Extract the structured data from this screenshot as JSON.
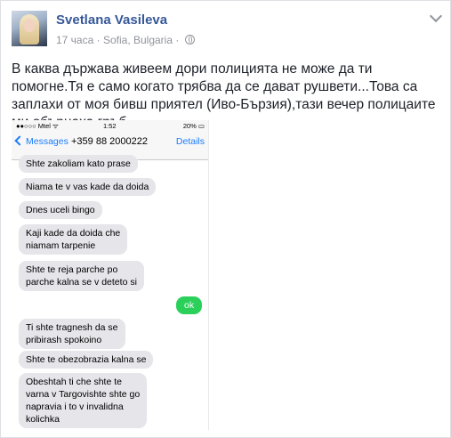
{
  "post": {
    "author": "Svetlana Vasileva",
    "time": "17 часа",
    "separator": "·",
    "location": "Sofia, Bulgaria",
    "separator2": "·",
    "text": "В каква държава живеем дори полицията не може да ти помогне.Тя е само когато трябва да се дават рушвети...Това са заплахи от моя бивш приятел (Иво-Бързия),тази вечер полицаите ми обърнаха гръб..."
  },
  "icons": {
    "privacy": "globe-icon",
    "menu": "chevron-down-icon",
    "back": "chevron-left-icon"
  },
  "phone": {
    "status": {
      "carrier": "●●○○○ Mtel ᯤ",
      "time": "1:52",
      "battery": "20% ▭"
    },
    "nav": {
      "back": "Messages",
      "number": "+359 88 2000222",
      "details": "Details"
    },
    "messages": [
      {
        "dir": "in",
        "text": "Shte zakoliam kato prase"
      },
      {
        "dir": "in",
        "text": "Niama te v vas kade da doida"
      },
      {
        "dir": "in",
        "text": "Dnes uceli bingo"
      },
      {
        "dir": "in",
        "text": "Kaji kade da doida che\nniamam tarpenie"
      },
      {
        "dir": "in",
        "text": "Shte te reja parche po\nparche kalna se v deteto si"
      },
      {
        "dir": "out",
        "text": "ok"
      },
      {
        "dir": "in",
        "text": "Ti shte tragnesh da se\npribirash spokoino"
      },
      {
        "dir": "in",
        "text": "Shte te obezobrazia kalna se"
      },
      {
        "dir": "in",
        "text": "Obeshtah ti che shte te\nvarna v Targovishte shte go\nnapravia i to v invalidna\nkolichka"
      }
    ]
  },
  "colors": {
    "author": "#365899",
    "ios_blue": "#1a7dfc",
    "bubble_in": "#e5e5ea",
    "bubble_out": "#2ad05a"
  }
}
